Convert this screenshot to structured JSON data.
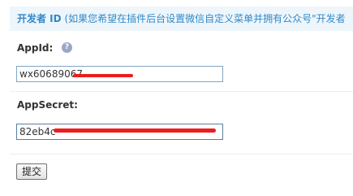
{
  "header": {
    "title_strong": "开发者 ID",
    "title_note": "(如果您希望在插件后台设置微信自定义菜单并拥有公众号\"开发者"
  },
  "appid": {
    "label": "AppId:",
    "help_icon_text": "?",
    "value": "wx60689067"
  },
  "appsecret": {
    "label": "AppSecret:",
    "value": "82eb4c"
  },
  "submit": {
    "label": "提交"
  },
  "colors": {
    "header_text": "#3189c9",
    "header_band": "#eef6fb",
    "redaction": "#ee1c1c",
    "input_border": "#7fa6c4"
  }
}
